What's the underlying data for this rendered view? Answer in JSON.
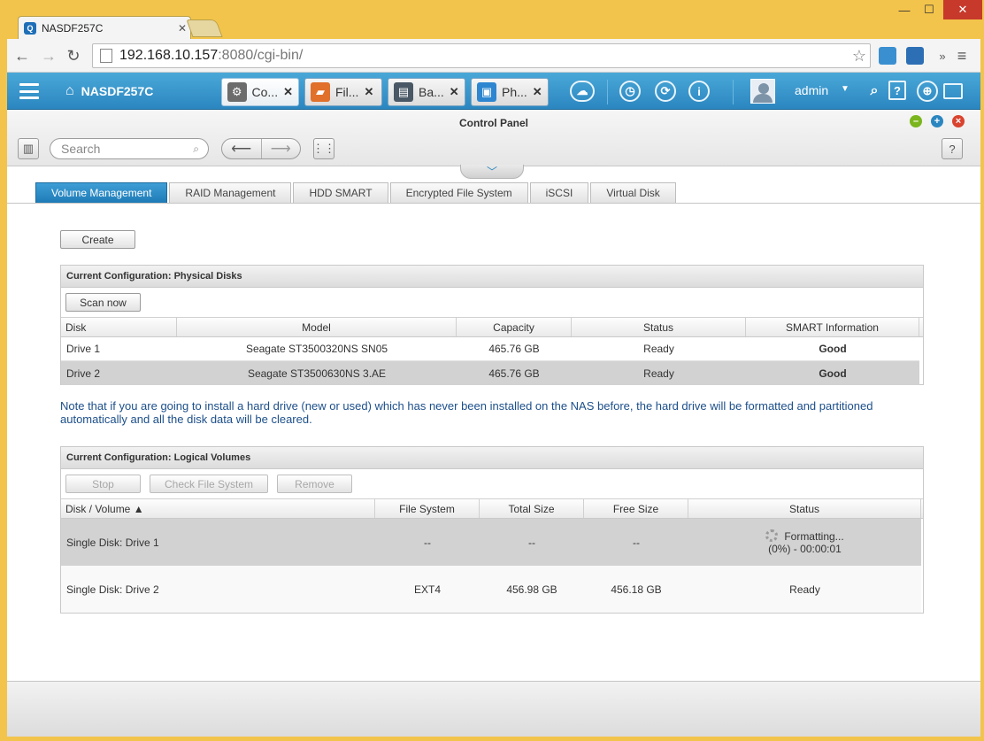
{
  "browser": {
    "tab_title": "NASDF257C",
    "tab_favicon": "Q",
    "url_host": "192.168.10.157",
    "url_path": ":8080/cgi-bin/",
    "overflow_label": "»"
  },
  "app_bar": {
    "home_label": "NASDF257C",
    "user": "admin",
    "tabs": [
      {
        "label": "Co...",
        "icon": "gear-icon",
        "color": "#6c6c6c"
      },
      {
        "label": "Fil...",
        "icon": "folder-icon",
        "color": "#e0702a"
      },
      {
        "label": "Ba...",
        "icon": "backup-icon",
        "color": "#4a5866"
      },
      {
        "label": "Ph...",
        "icon": "photo-icon",
        "color": "#2e86d0"
      }
    ]
  },
  "window": {
    "title": "Control Panel",
    "search_placeholder": "Search",
    "help_label": "?"
  },
  "tabs": [
    {
      "label": "Volume Management",
      "active": true
    },
    {
      "label": "RAID Management",
      "active": false
    },
    {
      "label": "HDD SMART",
      "active": false
    },
    {
      "label": "Encrypted File System",
      "active": false
    },
    {
      "label": "iSCSI",
      "active": false
    },
    {
      "label": "Virtual Disk",
      "active": false
    }
  ],
  "create_label": "Create",
  "physical": {
    "title": "Current Configuration: Physical Disks",
    "scan_label": "Scan now",
    "columns": [
      "Disk",
      "Model",
      "Capacity",
      "Status",
      "SMART Information"
    ],
    "rows": [
      {
        "disk": "Drive 1",
        "model": "Seagate ST3500320NS SN05",
        "capacity": "465.76 GB",
        "status": "Ready",
        "smart": "Good"
      },
      {
        "disk": "Drive 2",
        "model": "Seagate ST3500630NS 3.AE",
        "capacity": "465.76 GB",
        "status": "Ready",
        "smart": "Good"
      }
    ]
  },
  "note": "Note that if you are going to install a hard drive (new or used) which has never been installed on the NAS before, the hard drive will be formatted and partitioned automatically and all the disk data will be cleared.",
  "logical": {
    "title": "Current Configuration: Logical Volumes",
    "buttons": {
      "stop": "Stop",
      "check": "Check File System",
      "remove": "Remove"
    },
    "columns": [
      "Disk / Volume ▲",
      "File System",
      "Total Size",
      "Free Size",
      "Status"
    ],
    "rows": [
      {
        "volume": "Single Disk: Drive 1",
        "fs": "--",
        "total": "--",
        "free": "--",
        "status": "Formatting...",
        "status2": "(0%) - 00:00:01"
      },
      {
        "volume": "Single Disk: Drive 2",
        "fs": "EXT4",
        "total": "456.98 GB",
        "free": "456.18 GB",
        "status": "Ready",
        "status2": ""
      }
    ]
  },
  "colors": {
    "accent": "#2b86c0",
    "good": "#2a8a12",
    "note": "#1c4f8a",
    "selected_row": "#d2d2d2"
  }
}
